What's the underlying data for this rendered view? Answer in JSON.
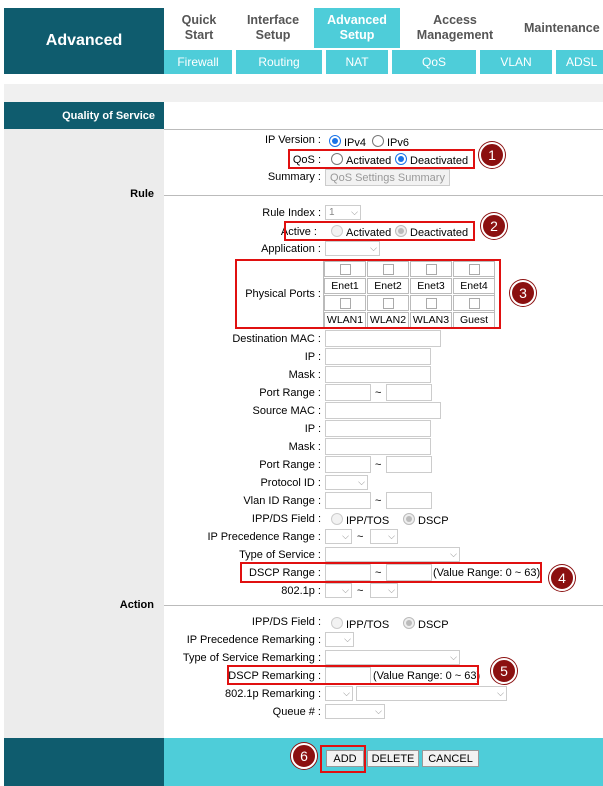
{
  "header": {
    "brand": "Advanced",
    "top_tabs": [
      {
        "label": "Quick\nStart",
        "active": false
      },
      {
        "label": "Interface\nSetup",
        "active": false
      },
      {
        "label": "Advanced\nSetup",
        "active": true
      },
      {
        "label": "Access\nManagement",
        "active": false
      },
      {
        "label": "Maintenance",
        "active": false
      }
    ],
    "sub_tabs": [
      "Firewall",
      "Routing",
      "NAT",
      "QoS",
      "VLAN",
      "ADSL"
    ]
  },
  "sections": {
    "qos": "Quality of Service",
    "rule": "Rule",
    "action": "Action"
  },
  "qos_top": {
    "ip_version_label": "IP Version :",
    "ipv4": "IPv4",
    "ipv6": "IPv6",
    "qos_label": "QoS :",
    "activated": "Activated",
    "deactivated": "Deactivated",
    "summary_label": "Summary :",
    "summary_button": "QoS Settings Summary"
  },
  "rule": {
    "rule_index_label": "Rule Index :",
    "rule_index_value": "1",
    "active_label": "Active :",
    "activated": "Activated",
    "deactivated": "Deactivated",
    "application_label": "Application :",
    "physical_ports_label": "Physical Ports :",
    "ports_row1": [
      "Enet1",
      "Enet2",
      "Enet3",
      "Enet4"
    ],
    "ports_row2": [
      "WLAN1",
      "WLAN2",
      "WLAN3",
      "Guest"
    ],
    "dest_mac_label": "Destination MAC :",
    "ip_label": "IP :",
    "mask_label": "Mask :",
    "port_range_label": "Port Range :",
    "src_mac_label": "Source MAC :",
    "ip2_label": "IP :",
    "mask2_label": "Mask :",
    "port_range2_label": "Port Range :",
    "protocol_label": "Protocol ID :",
    "vlan_label": "Vlan ID Range :",
    "ippds_label": "IPP/DS Field :",
    "ipptos": "IPP/TOS",
    "dscp": "DSCP",
    "ip_prec_label": "IP Precedence Range :",
    "tos_label": "Type of Service :",
    "dscp_range_label": "DSCP Range :",
    "dscp_range_hint": "(Value Range: 0 ~ 63)",
    "p8021_label": "802.1p :",
    "tilde": "~"
  },
  "action": {
    "ippds_label": "IPP/DS Field :",
    "ipptos": "IPP/TOS",
    "dscp": "DSCP",
    "ip_prec_label": "IP Precedence Remarking :",
    "tos_label": "Type of Service Remarking :",
    "dscp_label": "DSCP Remarking :",
    "dscp_hint": "(Value Range: 0 ~ 63)",
    "p8021_label": "802.1p Remarking :",
    "queue_label": "Queue # :"
  },
  "buttons": {
    "add": "ADD",
    "delete": "DELETE",
    "cancel": "CANCEL"
  },
  "badges": [
    "1",
    "2",
    "3",
    "4",
    "5",
    "6"
  ],
  "colors": {
    "dark_teal": "#0f5c6e",
    "light_teal": "#4ecdd9",
    "annotation_red": "#e01010",
    "badge": "#8b1010"
  }
}
